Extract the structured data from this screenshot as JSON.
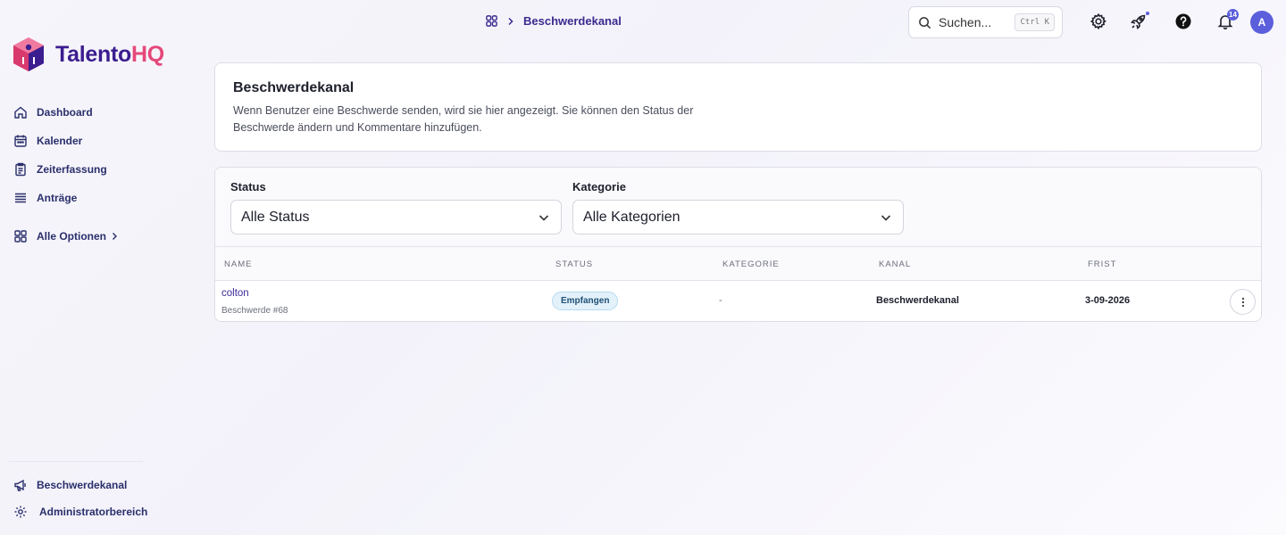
{
  "brand": {
    "name_part1": "Talento",
    "name_part2": "HQ",
    "color_primary": "#3b1d8f",
    "color_accent": "#e5487a"
  },
  "sidebar": {
    "items": [
      {
        "label": "Dashboard",
        "icon": "home-icon"
      },
      {
        "label": "Kalender",
        "icon": "calendar-icon"
      },
      {
        "label": "Zeiterfassung",
        "icon": "clipboard-icon"
      },
      {
        "label": "Anträge",
        "icon": "list-icon"
      }
    ],
    "more_label": "Alle Optionen",
    "bottom_items": [
      {
        "label": "Beschwerdekanal",
        "icon": "megaphone-icon"
      },
      {
        "label": "Administratorbereich",
        "icon": "gear-icon"
      }
    ]
  },
  "topbar": {
    "breadcrumb_current": "Beschwerdekanal",
    "search_placeholder": "Suchen...",
    "search_shortcut": "Ctrl K",
    "notification_count": "14",
    "avatar_initial": "A"
  },
  "intro": {
    "title": "Beschwerdekanal",
    "description": "Wenn Benutzer eine Beschwerde senden, wird sie hier angezeigt. Sie können den Status der Beschwerde ändern und Kommentare hinzufügen."
  },
  "filters": {
    "status_label": "Status",
    "status_value": "Alle Status",
    "category_label": "Kategorie",
    "category_value": "Alle Kategorien"
  },
  "table": {
    "columns": [
      "NAME",
      "STATUS",
      "KATEGORIE",
      "KANAL",
      "FRIST"
    ],
    "rows": [
      {
        "name": "colton",
        "sub": "Beschwerde #68",
        "status": "Empfangen",
        "category": "-",
        "channel": "Beschwerdekanal",
        "deadline": "3-09-2026"
      }
    ]
  }
}
